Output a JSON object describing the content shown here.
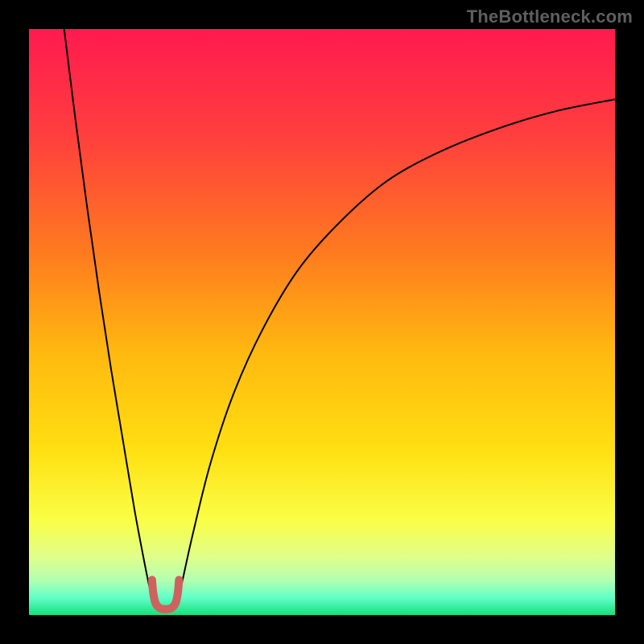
{
  "watermark": "TheBottleneck.com",
  "chart_data": {
    "type": "line",
    "title": "",
    "xlabel": "",
    "ylabel": "",
    "xlim": [
      0,
      100
    ],
    "ylim": [
      0,
      100
    ],
    "grid": false,
    "legend": false,
    "background_gradient": {
      "stops": [
        {
          "offset": 0.0,
          "color": "#ff1a4f"
        },
        {
          "offset": 0.18,
          "color": "#ff3e3e"
        },
        {
          "offset": 0.38,
          "color": "#ff7a1f"
        },
        {
          "offset": 0.55,
          "color": "#ffb80f"
        },
        {
          "offset": 0.72,
          "color": "#ffe012"
        },
        {
          "offset": 0.84,
          "color": "#f9ff47"
        },
        {
          "offset": 0.9,
          "color": "#e0ff8a"
        },
        {
          "offset": 0.94,
          "color": "#b4ffb0"
        },
        {
          "offset": 0.97,
          "color": "#63ffc8"
        },
        {
          "offset": 1.0,
          "color": "#17e07a"
        }
      ]
    },
    "series": [
      {
        "name": "left-curve",
        "stroke": "#000000",
        "stroke_width": 2,
        "x": [
          6,
          8,
          10,
          12,
          14,
          16,
          18,
          19.5,
          20.5,
          21.3
        ],
        "y": [
          100,
          84,
          69,
          55,
          42,
          30,
          18,
          10,
          5,
          1.5
        ]
      },
      {
        "name": "right-curve",
        "stroke": "#000000",
        "stroke_width": 2,
        "x": [
          25.2,
          26,
          28,
          31,
          35,
          40,
          46,
          53,
          61,
          70,
          80,
          90,
          100
        ],
        "y": [
          1.5,
          5,
          14,
          26,
          38,
          49,
          59,
          67,
          74,
          79,
          83,
          86,
          88
        ]
      },
      {
        "name": "u-marker",
        "stroke": "#cf615e",
        "stroke_width": 10,
        "linecap": "round",
        "x": [
          21.0,
          21.2,
          21.6,
          22.3,
          23.3,
          24.3,
          25.0,
          25.4,
          25.6
        ],
        "y": [
          6.0,
          3.8,
          2.0,
          1.2,
          1.0,
          1.2,
          2.0,
          3.8,
          6.0
        ]
      }
    ]
  }
}
